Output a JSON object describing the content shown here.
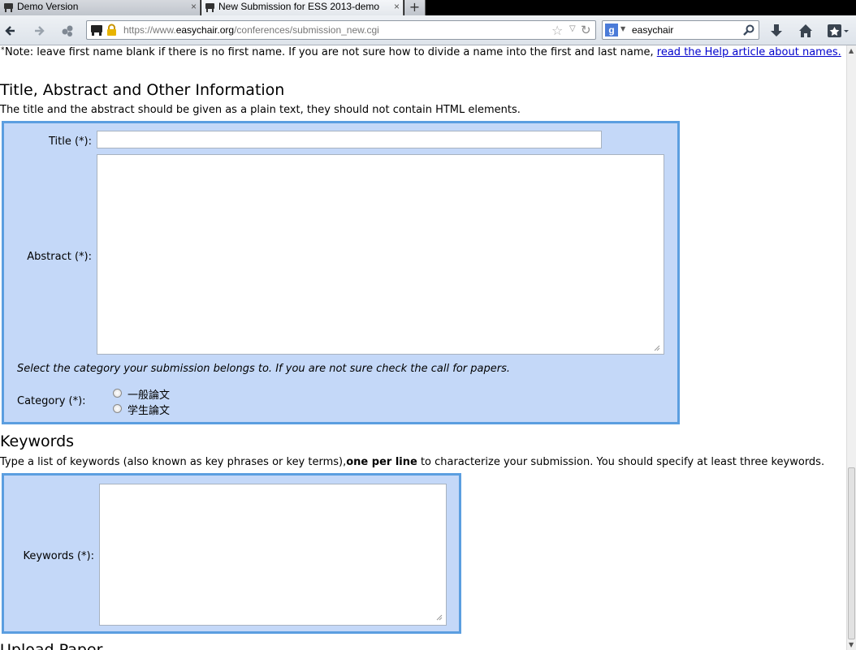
{
  "browser": {
    "tabs": [
      {
        "label": "Demo Version",
        "close": "×"
      },
      {
        "label": "New Submission for ESS 2013-demo",
        "close": "×"
      }
    ],
    "new_tab": "+",
    "url_prefix": "https://www.",
    "url_domain": "easychair.org",
    "url_path": "/conferences/submission_new.cgi",
    "search_engine": "g",
    "search_text": "easychair"
  },
  "page": {
    "note_prefix": "*",
    "note_text": " Note: leave first name blank if there is no first name. If you are not sure how to divide a name into the first and last name, ",
    "note_link": "read the Help article about names.",
    "section_title": "Title, Abstract and Other Information",
    "section_desc": "The title and the abstract should be given as a plain text, they should not contain HTML elements.",
    "form": {
      "title_label": "Title (*):",
      "title_value": "",
      "abstract_label": "Abstract (*):",
      "abstract_value": "",
      "category_hint": "Select the category your submission belongs to. If you are not sure check the call for papers.",
      "category_label": "Category (*):",
      "category_options": [
        "一般論文",
        "学生論文"
      ]
    },
    "keywords_title": "Keywords",
    "keywords_desc_pre": "Type a list of keywords (also known as key phrases or key terms),",
    "keywords_desc_bold": "one per line",
    "keywords_desc_post": " to characterize your submission. You should specify at least three keywords.",
    "keywords_label": "Keywords (*):",
    "keywords_value": "",
    "upload_title": "Upload Paper"
  },
  "colors": {
    "form_bg": "#c4d8f8",
    "form_border": "#5b9ee0",
    "link": "#0000cc"
  }
}
